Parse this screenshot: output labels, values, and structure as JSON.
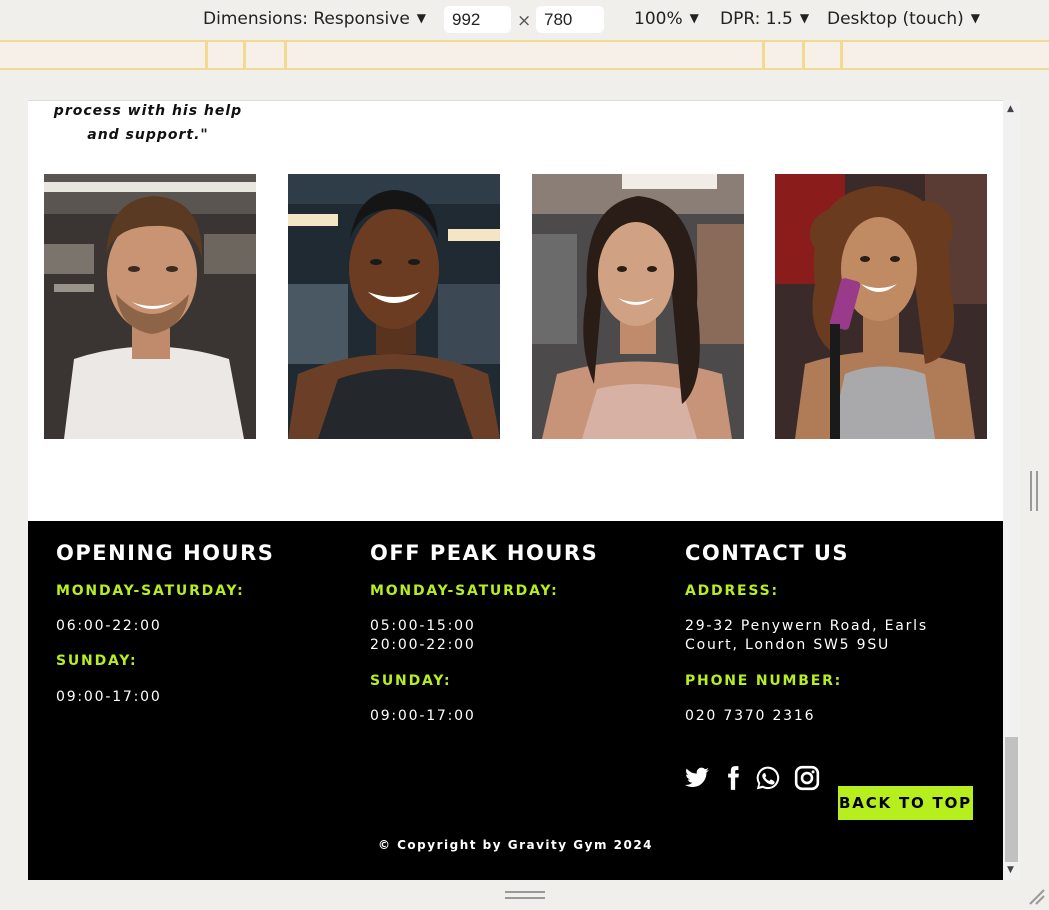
{
  "devtools": {
    "dimensions_label": "Dimensions: Responsive",
    "width_value": "992",
    "height_value": "780",
    "times_symbol": "×",
    "zoom": "100%",
    "dpr": "DPR: 1.5",
    "device_mode": "Desktop (touch)"
  },
  "page": {
    "quote_line1": "process with his help",
    "quote_line2": "and support.\"",
    "trainers": [
      {
        "name": "trainer-male-1"
      },
      {
        "name": "trainer-male-2"
      },
      {
        "name": "trainer-female-1"
      },
      {
        "name": "trainer-female-2"
      }
    ]
  },
  "footer": {
    "opening": {
      "title": "OPENING HOURS",
      "weekday_label": "MONDAY-SATURDAY:",
      "weekday_hours": "06:00-22:00",
      "sunday_label": "SUNDAY:",
      "sunday_hours": "09:00-17:00"
    },
    "offpeak": {
      "title": "OFF PEAK HOURS",
      "weekday_label": "MONDAY-SATURDAY:",
      "weekday_hours_1": "05:00-15:00",
      "weekday_hours_2": "20:00-22:00",
      "sunday_label": "SUNDAY:",
      "sunday_hours": "09:00-17:00"
    },
    "contact": {
      "title": "CONTACT US",
      "address_label": "ADDRESS:",
      "address_line1": "29-32 Penywern Road, Earls",
      "address_line2": "Court, London SW5 9SU",
      "phone_label": "PHONE NUMBER:",
      "phone": "020 7370 2316"
    },
    "social": [
      "twitter-icon",
      "facebook-icon",
      "whatsapp-icon",
      "instagram-icon"
    ],
    "back_to_top": "BACK TO TOP",
    "copyright": "© Copyright by Gravity Gym 2024",
    "accent_color": "#b6ee1e"
  }
}
